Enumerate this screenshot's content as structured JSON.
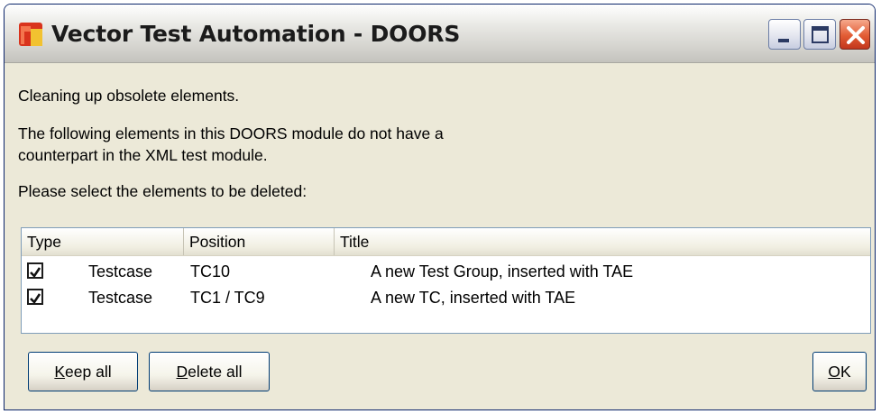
{
  "window": {
    "title": "Vector Test Automation - DOORS",
    "icon": "vector-app-icon"
  },
  "titlebar_buttons": {
    "minimize": "minimize-icon",
    "maximize": "maximize-icon",
    "close": "close-icon"
  },
  "message": {
    "line1": "Cleaning up obsolete elements.",
    "line2": "The following elements in this DOORS module do not have a counterpart in the XML test module.",
    "line3": "Please select the elements to be deleted:"
  },
  "table": {
    "columns": [
      "Type",
      "Position",
      "Title"
    ],
    "rows": [
      {
        "checked": true,
        "type": "Testcase",
        "position": "TC10",
        "title": "A new Test Group, inserted with TAE"
      },
      {
        "checked": true,
        "type": "Testcase",
        "position": "TC1 / TC9",
        "title": "A new TC, inserted with TAE"
      }
    ]
  },
  "buttons": {
    "keep_all": {
      "mnemonic": "K",
      "rest": "eep all"
    },
    "delete_all": {
      "mnemonic": "D",
      "rest": "elete all"
    },
    "ok": {
      "mnemonic": "O",
      "rest": "K"
    }
  },
  "colors": {
    "dialog_bg": "#ece9d8",
    "close_button": "#e25c34",
    "icon_red": "#d9331c",
    "icon_yellow": "#f2c230"
  }
}
